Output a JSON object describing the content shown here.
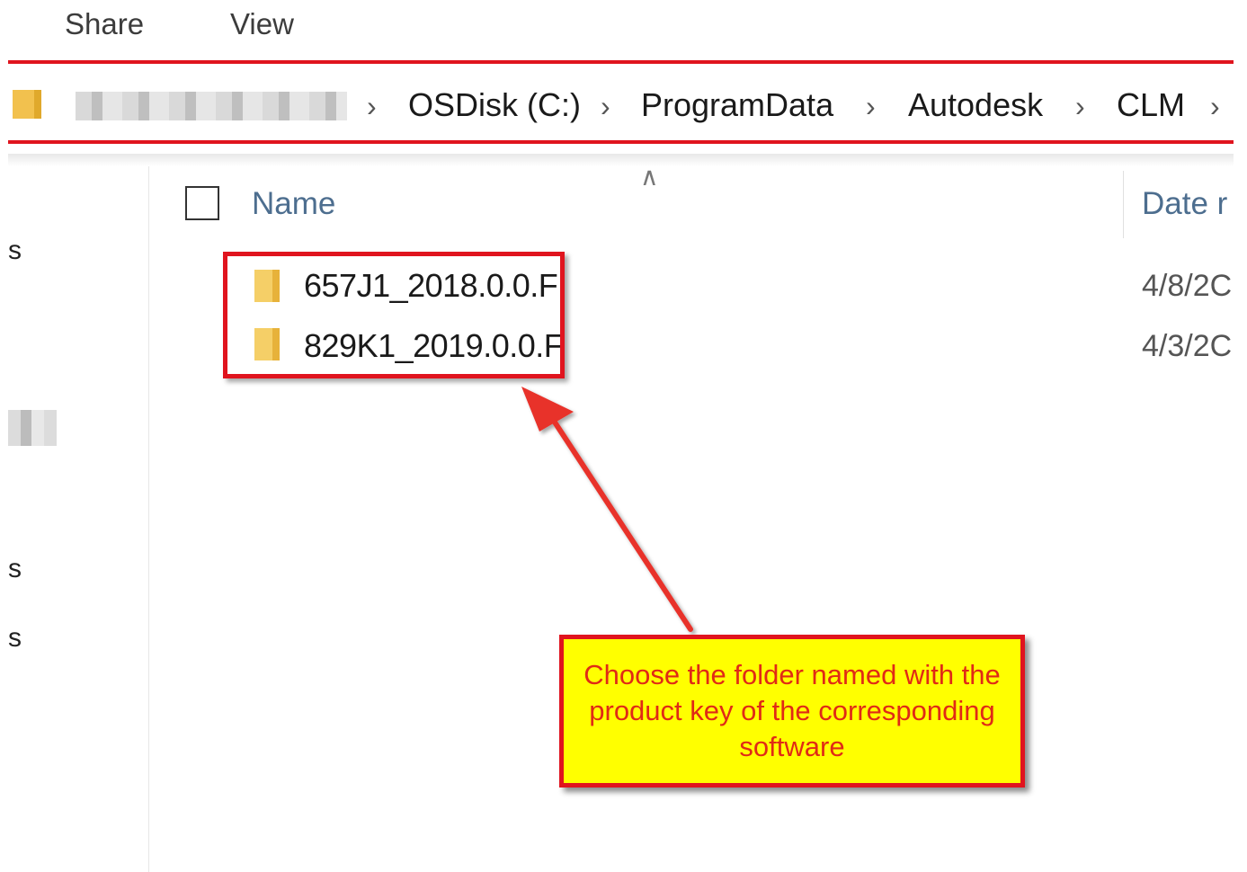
{
  "ribbon": {
    "tabs": [
      {
        "label": "Share"
      },
      {
        "label": "View"
      }
    ]
  },
  "address_bar": {
    "crumbs": [
      "OSDisk (C:)",
      "ProgramData",
      "Autodesk",
      "CLM"
    ],
    "chevron": "›"
  },
  "nav_pane": {
    "fragments": [
      "s",
      "s",
      "s"
    ]
  },
  "file_list": {
    "columns": {
      "name": "Name",
      "date": "Date r"
    },
    "rows": [
      {
        "name": "657J1_2018.0.0.F",
        "date": "4/8/2C"
      },
      {
        "name": "829K1_2019.0.0.F",
        "date": "4/3/2C"
      }
    ]
  },
  "annotation": {
    "callout_text": "Choose the folder named with the product key of the corresponding  software",
    "colors": {
      "highlight": "#e0141e",
      "callout_fill": "#ffff00",
      "callout_text": "#e02a16"
    }
  },
  "icons": {
    "folder": "folder-icon",
    "chevron": "chevron-right-icon",
    "sort": "sort-ascending-icon"
  }
}
